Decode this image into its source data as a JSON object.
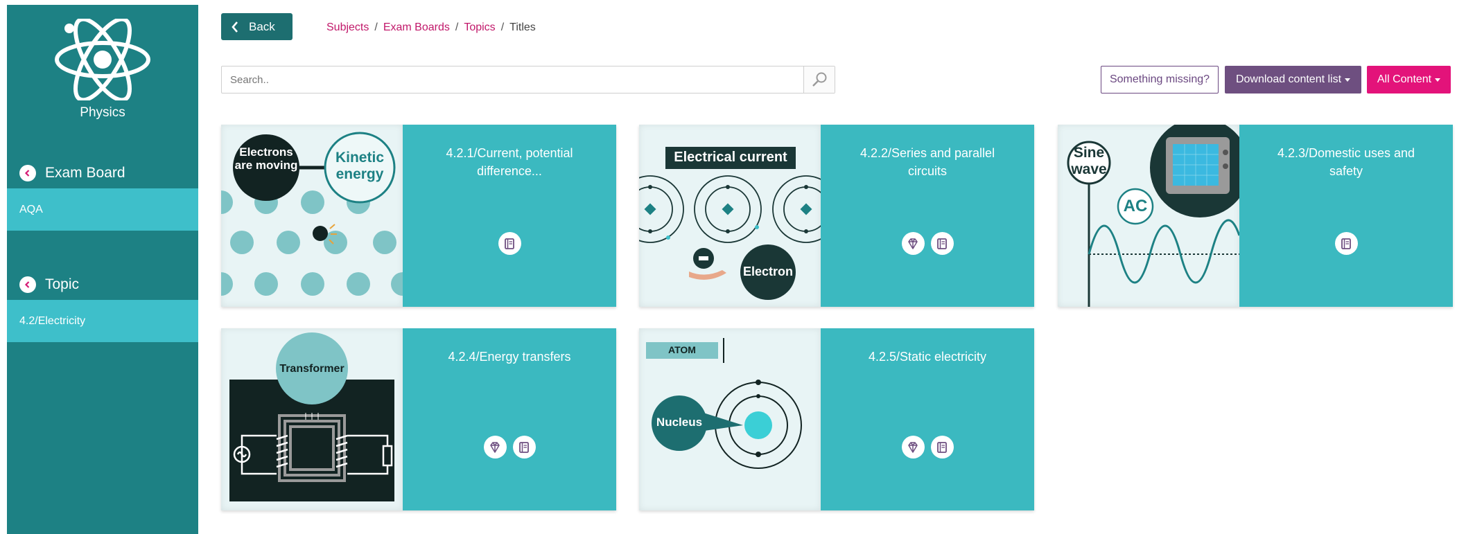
{
  "sidebar": {
    "subject": "Physics",
    "exam_board_heading": "Exam Board",
    "exam_board_selected": "AQA",
    "topic_heading": "Topic",
    "topic_selected": "4.2/Electricity"
  },
  "topbar": {
    "back_label": "Back",
    "breadcrumb": [
      "Subjects",
      "Exam Boards",
      "Topics",
      "Titles"
    ],
    "breadcrumb_sep": "/",
    "search_placeholder": "Search..",
    "missing_label": "Something missing?",
    "download_label": "Download content list",
    "all_content_label": "All Content"
  },
  "cards": [
    {
      "title": "4.2.1/Current, potential difference...",
      "icons": [
        "book-icon"
      ],
      "thumb": {
        "bubble_left": "Electrons are moving",
        "bubble_right": "Kinetic energy"
      }
    },
    {
      "title": "4.2.2/Series and parallel circuits",
      "icons": [
        "gem-icon",
        "book-icon"
      ],
      "thumb": {
        "banner": "Electrical current",
        "bubble": "Electron"
      }
    },
    {
      "title": "4.2.3/Domestic uses and safety",
      "icons": [
        "book-icon"
      ],
      "thumb": {
        "bubble_left": "Sine wave",
        "bubble_mid": "AC"
      }
    },
    {
      "title": "4.2.4/Energy transfers",
      "icons": [
        "gem-icon",
        "book-icon"
      ],
      "thumb": {
        "bubble": "Transformer"
      }
    },
    {
      "title": "4.2.5/Static electricity",
      "icons": [
        "gem-icon",
        "book-icon"
      ],
      "thumb": {
        "label": "ATOM",
        "bubble": "Nucleus"
      }
    }
  ],
  "colors": {
    "sidebar": "#1d8184",
    "sidebar_selected": "#3ebfca",
    "card": "#3bb9c0",
    "breadcrumb_link": "#c1186a",
    "download": "#6e4f80",
    "all_content": "#e3137a"
  }
}
